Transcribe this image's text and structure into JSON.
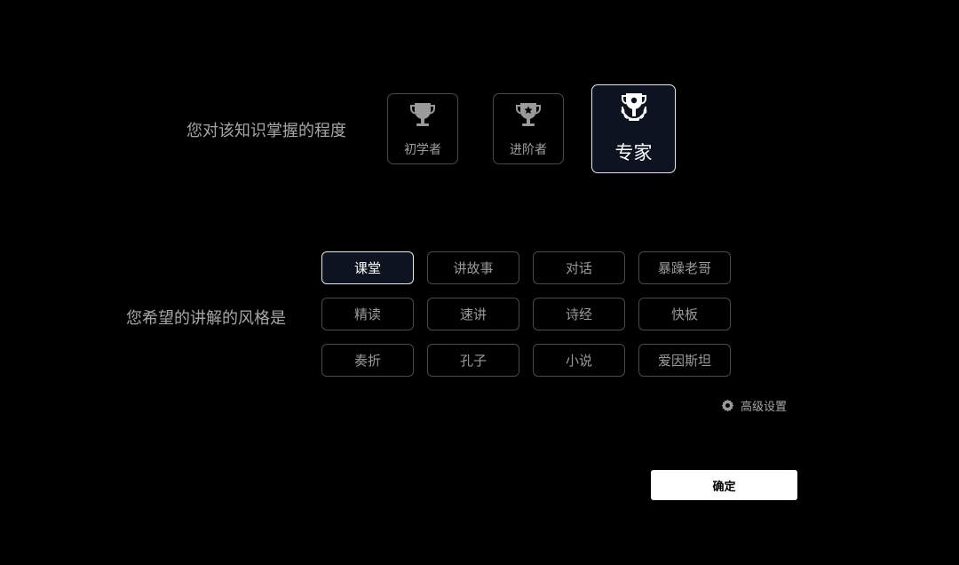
{
  "knowledge_level": {
    "label": "您对该知识掌握的程度",
    "options": [
      {
        "label": "初学者",
        "icon": "trophy-icon",
        "selected": false
      },
      {
        "label": "进阶者",
        "icon": "trophy-star-icon",
        "selected": false
      },
      {
        "label": "专家",
        "icon": "trophy-laurel-icon",
        "selected": true
      }
    ]
  },
  "explanation_style": {
    "label": "您希望的讲解的风格是",
    "options": [
      {
        "label": "课堂",
        "selected": true
      },
      {
        "label": "讲故事",
        "selected": false
      },
      {
        "label": "对话",
        "selected": false
      },
      {
        "label": "暴躁老哥",
        "selected": false
      },
      {
        "label": "精读",
        "selected": false
      },
      {
        "label": "速讲",
        "selected": false
      },
      {
        "label": "诗经",
        "selected": false
      },
      {
        "label": "快板",
        "selected": false
      },
      {
        "label": "奏折",
        "selected": false
      },
      {
        "label": "孔子",
        "selected": false
      },
      {
        "label": "小说",
        "selected": false
      },
      {
        "label": "爱因斯坦",
        "selected": false
      }
    ]
  },
  "advanced_settings": {
    "label": "高级设置",
    "icon": "gear-icon"
  },
  "confirm_button": {
    "label": "确定"
  },
  "colors": {
    "background": "#000000",
    "selected_fill": "#0d1320",
    "selected_border": "#e6e6e6",
    "unselected_border": "#4a4a4a",
    "muted_text": "#a0a0a0",
    "confirm_bg": "#ffffff"
  }
}
